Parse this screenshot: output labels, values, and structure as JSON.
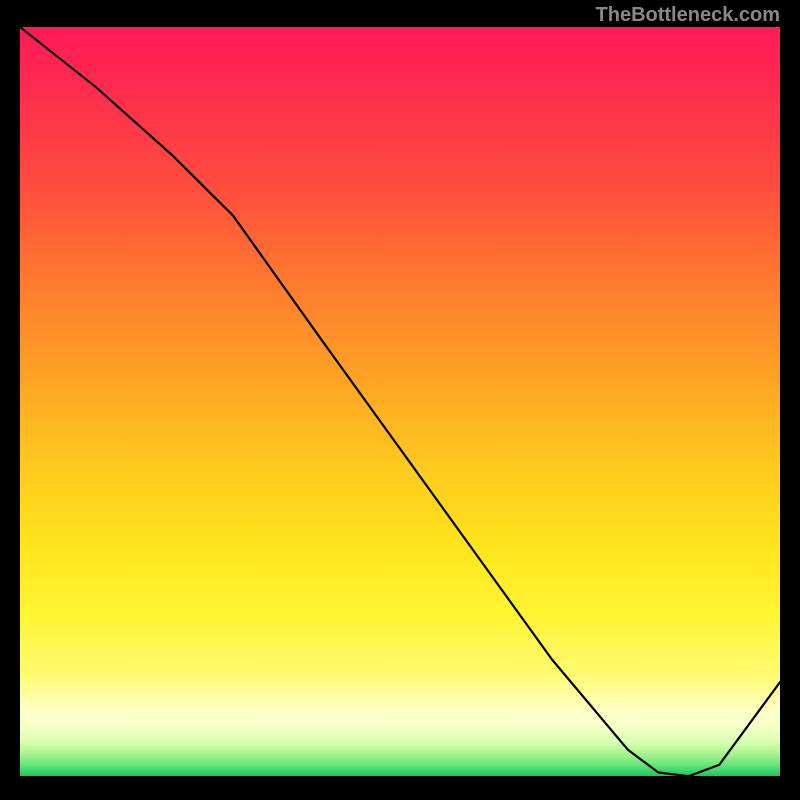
{
  "watermark": "TheBottleneck.com",
  "label_bottom": "",
  "chart_data": {
    "type": "line",
    "title": "",
    "xlabel": "",
    "ylabel": "",
    "xlim": [
      0,
      100
    ],
    "ylim": [
      0,
      100
    ],
    "legend": false,
    "grid": false,
    "series": [
      {
        "name": "curve",
        "x": [
          0,
          10,
          20,
          28,
          40,
          50,
          60,
          70,
          80,
          84,
          88,
          92,
          100
        ],
        "y": [
          100,
          92,
          83,
          75,
          58,
          44,
          30,
          16,
          4,
          1,
          0.5,
          2,
          13
        ]
      }
    ],
    "annotations": [
      {
        "x": 80,
        "y": 1.5,
        "text": ""
      }
    ],
    "background_gradient": {
      "direction": "vertical",
      "stops": [
        {
          "pos": 0.0,
          "color": "#ff1a57"
        },
        {
          "pos": 0.22,
          "color": "#ff4f3d"
        },
        {
          "pos": 0.46,
          "color": "#ffa126"
        },
        {
          "pos": 0.68,
          "color": "#ffe31a"
        },
        {
          "pos": 0.91,
          "color": "#ffffc8"
        },
        {
          "pos": 0.97,
          "color": "#a8f58e"
        },
        {
          "pos": 1.0,
          "color": "#12b85a"
        }
      ]
    }
  }
}
